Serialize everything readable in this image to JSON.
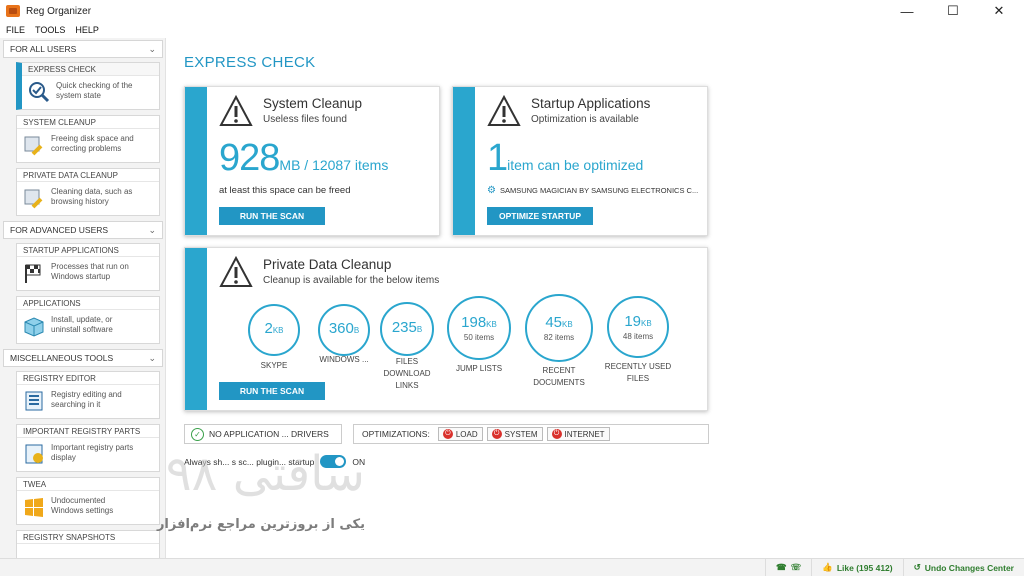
{
  "window": {
    "title": "Reg Organizer",
    "min": "—",
    "max": "☐",
    "close": "✕"
  },
  "menu": [
    "FILE",
    "TOOLS",
    "HELP"
  ],
  "sidebar": {
    "sections": [
      {
        "label": "FOR ALL USERS",
        "items": [
          {
            "title": "EXPRESS CHECK",
            "desc1": "Quick checking of the",
            "desc2": "system state",
            "icon": "magnifier-check-icon"
          },
          {
            "title": "SYSTEM CLEANUP",
            "desc1": "Freeing disk space and",
            "desc2": "correcting problems",
            "icon": "broom-icon"
          },
          {
            "title": "PRIVATE DATA CLEANUP",
            "desc1": "Cleaning data, such as",
            "desc2": "browsing history",
            "icon": "privacy-broom-icon"
          }
        ]
      },
      {
        "label": "FOR ADVANCED USERS",
        "items": [
          {
            "title": "STARTUP APPLICATIONS",
            "desc1": "Processes that run on",
            "desc2": "Windows startup",
            "icon": "startup-flag-icon"
          },
          {
            "title": "APPLICATIONS",
            "desc1": "Install, update, or",
            "desc2": "uninstall software",
            "icon": "box-icon"
          }
        ]
      },
      {
        "label": "MISCELLANEOUS TOOLS",
        "items": [
          {
            "title": "REGISTRY EDITOR",
            "desc1": "Registry editing and",
            "desc2": "searching in it",
            "icon": "registry-icon"
          },
          {
            "title": "IMPORTANT REGISTRY PARTS",
            "desc1": "Important registry parts",
            "desc2": "display",
            "icon": "registry-parts-icon"
          },
          {
            "title": "TWEA",
            "desc1": "Undocumented",
            "desc2": "Windows settings",
            "icon": "windows-icon"
          },
          {
            "title": "REGISTRY SNAPSHOTS",
            "desc1": "",
            "desc2": "",
            "icon": "snapshot-icon"
          }
        ]
      }
    ]
  },
  "main": {
    "title": "EXPRESS CHECK",
    "system_cleanup": {
      "title": "System Cleanup",
      "subtitle": "Useless files found",
      "size": "928",
      "size_unit": "MB",
      "items": " / 12087 items",
      "note": "at least this space can be freed",
      "button": "RUN THE SCAN"
    },
    "startup": {
      "title": "Startup Applications",
      "subtitle": "Optimization is available",
      "count": "1",
      "count_text": "item can be optimized",
      "app": "SAMSUNG MAGICIAN BY SAMSUNG ELECTRONICS C...",
      "button": "OPTIMIZE STARTUP"
    },
    "private": {
      "title": "Private Data Cleanup",
      "subtitle": "Cleanup is available for the below items",
      "button": "RUN THE SCAN",
      "circles": [
        {
          "value": "2",
          "unit": "KB",
          "count": "",
          "label": "SKYPE"
        },
        {
          "value": "360",
          "unit": "B",
          "count": "",
          "label": "WINDOWS ..."
        },
        {
          "value": "235",
          "unit": "B",
          "count": "",
          "label": "FILES DOWNLOAD LINKS"
        },
        {
          "value": "198",
          "unit": "KB",
          "count": "50 items",
          "label": "JUMP LISTS"
        },
        {
          "value": "45",
          "unit": "KB",
          "count": "82 items",
          "label": "RECENT DOCUMENTS"
        },
        {
          "value": "19",
          "unit": "KB",
          "count": "48 items",
          "label": "RECENTLY USED FILES"
        }
      ]
    },
    "warn_bar": "NO APPLICATION ... DRIVERS",
    "optimizations": {
      "label": "OPTIMIZATIONS:",
      "items": [
        "LOAD",
        "SYSTEM",
        "INTERNET"
      ]
    },
    "toggle": {
      "label": "Always sh... s sc... plugin... startup",
      "state": "ON"
    }
  },
  "statusbar": {
    "like": "Like (195 412)",
    "undo": "Undo Changes Center"
  },
  "watermark": {
    "text1": "سافتی ۹۸",
    "text2": "یکی از بروزترین مراجع نرم‌افزار"
  },
  "colors": {
    "accent": "#2296c4",
    "stripe": "#2aa6ce",
    "status_green": "#2e7d2e"
  }
}
